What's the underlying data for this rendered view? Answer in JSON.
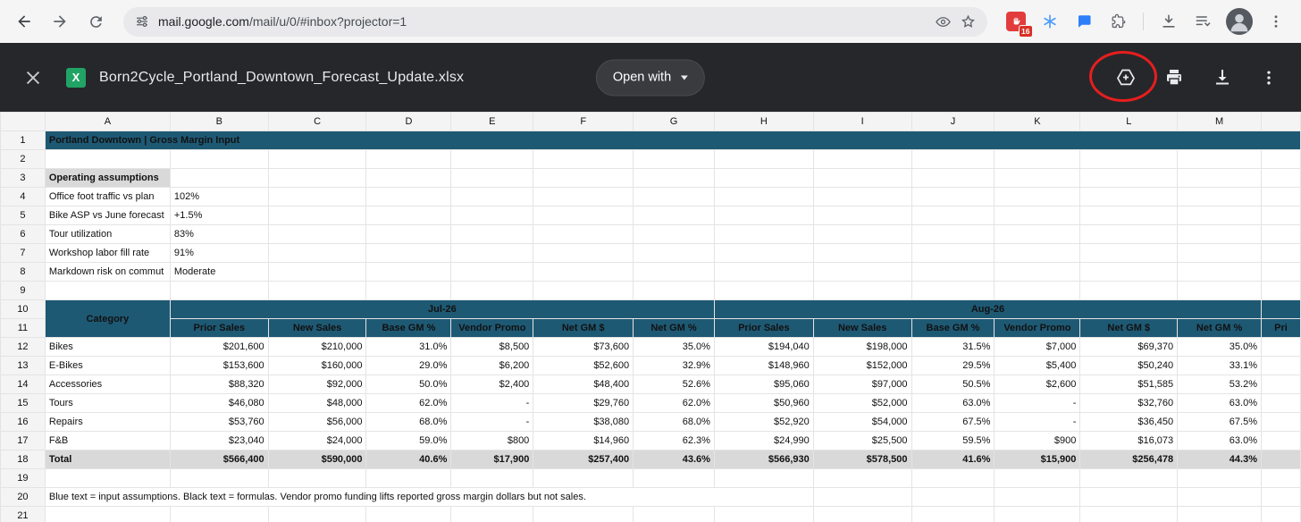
{
  "browser": {
    "url": {
      "host": "mail.google.com",
      "path": "/mail/u/0/#inbox?projector=1"
    },
    "extension_badge": "16"
  },
  "preview": {
    "filename": "Born2Cycle_Portland_Downtown_Forecast_Update.xlsx",
    "open_with": "Open with",
    "excel_icon_letter": "X"
  },
  "icons": {
    "browser": [
      "back-icon",
      "forward-icon",
      "reload-icon",
      "site-settings-icon",
      "eye-icon",
      "bookmark-star-icon",
      "adblock-icon",
      "snowflake-icon",
      "chat-icon",
      "puzzle-icon",
      "downloads-icon",
      "reading-list-icon",
      "avatar",
      "kebab-menu-icon"
    ],
    "preview": [
      "close-icon",
      "excel-file-icon",
      "chevron-down-icon",
      "add-to-drive-icon",
      "print-icon",
      "download-icon",
      "more-options-icon",
      "annotation-circle"
    ]
  },
  "sheet": {
    "col_letters": [
      "A",
      "B",
      "C",
      "D",
      "E",
      "F",
      "G",
      "H",
      "I",
      "J",
      "K",
      "L",
      "M"
    ],
    "title": "Portland Downtown | Gross Margin Input",
    "assumptions_header": "Operating assumptions",
    "assumptions": [
      {
        "label": "Office foot traffic vs plan",
        "value": "102%"
      },
      {
        "label": "Bike ASP vs June forecast",
        "value": "+1.5%"
      },
      {
        "label": "Tour utilization",
        "value": "83%"
      },
      {
        "label": "Workshop labor fill rate",
        "value": "91%"
      },
      {
        "label": "Markdown risk on commut",
        "value": "Moderate"
      }
    ],
    "table": {
      "category_header": "Category",
      "month_groups": [
        "Jul-26",
        "Aug-26"
      ],
      "sub_headers": [
        "Prior Sales",
        "New Sales",
        "Base GM %",
        "Vendor Promo",
        "Net GM $",
        "Net GM %"
      ],
      "partial_header": "Pri",
      "rows": [
        {
          "category": "Bikes",
          "values": [
            "$201,600",
            "$210,000",
            "31.0%",
            "$8,500",
            "$73,600",
            "35.0%",
            "$194,040",
            "$198,000",
            "31.5%",
            "$7,000",
            "$69,370",
            "35.0%"
          ]
        },
        {
          "category": "E-Bikes",
          "values": [
            "$153,600",
            "$160,000",
            "29.0%",
            "$6,200",
            "$52,600",
            "32.9%",
            "$148,960",
            "$152,000",
            "29.5%",
            "$5,400",
            "$50,240",
            "33.1%"
          ]
        },
        {
          "category": "Accessories",
          "values": [
            "$88,320",
            "$92,000",
            "50.0%",
            "$2,400",
            "$48,400",
            "52.6%",
            "$95,060",
            "$97,000",
            "50.5%",
            "$2,600",
            "$51,585",
            "53.2%"
          ]
        },
        {
          "category": "Tours",
          "values": [
            "$46,080",
            "$48,000",
            "62.0%",
            "-",
            "$29,760",
            "62.0%",
            "$50,960",
            "$52,000",
            "63.0%",
            "-",
            "$32,760",
            "63.0%"
          ]
        },
        {
          "category": "Repairs",
          "values": [
            "$53,760",
            "$56,000",
            "68.0%",
            "-",
            "$38,080",
            "68.0%",
            "$52,920",
            "$54,000",
            "67.5%",
            "-",
            "$36,450",
            "67.5%"
          ]
        },
        {
          "category": "F&B",
          "values": [
            "$23,040",
            "$24,000",
            "59.0%",
            "$800",
            "$14,960",
            "62.3%",
            "$24,990",
            "$25,500",
            "59.5%",
            "$900",
            "$16,073",
            "63.0%"
          ]
        }
      ],
      "total": {
        "category": "Total",
        "values": [
          "$566,400",
          "$590,000",
          "40.6%",
          "$17,900",
          "$257,400",
          "43.6%",
          "$566,930",
          "$578,500",
          "41.6%",
          "$15,900",
          "$256,478",
          "44.3%"
        ]
      }
    },
    "footnote": "Blue text = input assumptions. Black text = formulas. Vendor promo funding lifts reported gross margin dollars but not sales."
  },
  "colors": {
    "header_blue": "#1e5974",
    "total_gray": "#d9d9d9",
    "input_blue": "#2a5fc6",
    "annotation_red": "#e61e1e",
    "excel_green": "#21a366",
    "preview_header_bg": "#26272b"
  }
}
